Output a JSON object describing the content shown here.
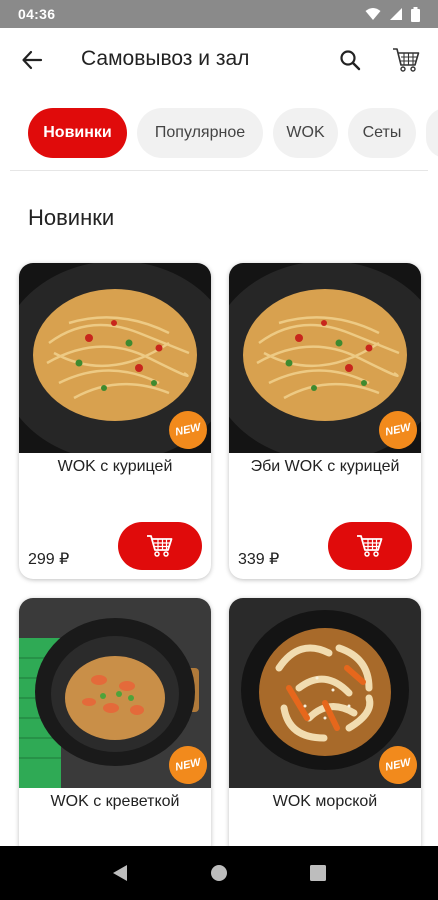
{
  "status_bar": {
    "time": "04:36",
    "icons": [
      "wifi-icon",
      "signal-icon",
      "battery-icon"
    ]
  },
  "app_bar": {
    "title": "Самовывоз и зал",
    "icons": [
      "back-arrow-icon",
      "search-icon",
      "cart-icon"
    ]
  },
  "categories": [
    {
      "label": "Новинки",
      "active": true
    },
    {
      "label": "Популярное",
      "active": false
    },
    {
      "label": "WOK",
      "active": false
    },
    {
      "label": "Сеты",
      "active": false
    }
  ],
  "section": {
    "title": "Новинки"
  },
  "products": [
    {
      "name": "WOK с курицей",
      "price": "299 ₽",
      "badge": "NEW"
    },
    {
      "name": "Эби WOK с курицей",
      "price": "339 ₽",
      "badge": "NEW"
    },
    {
      "name": "WOK с креветкой",
      "badge": "NEW"
    },
    {
      "name": "WOK морской",
      "badge": "NEW"
    }
  ],
  "colors": {
    "accent": "#e00b0b",
    "badge": "#f28a1c",
    "status_bar": "#8a8a8a",
    "nav_bar": "#000000"
  }
}
